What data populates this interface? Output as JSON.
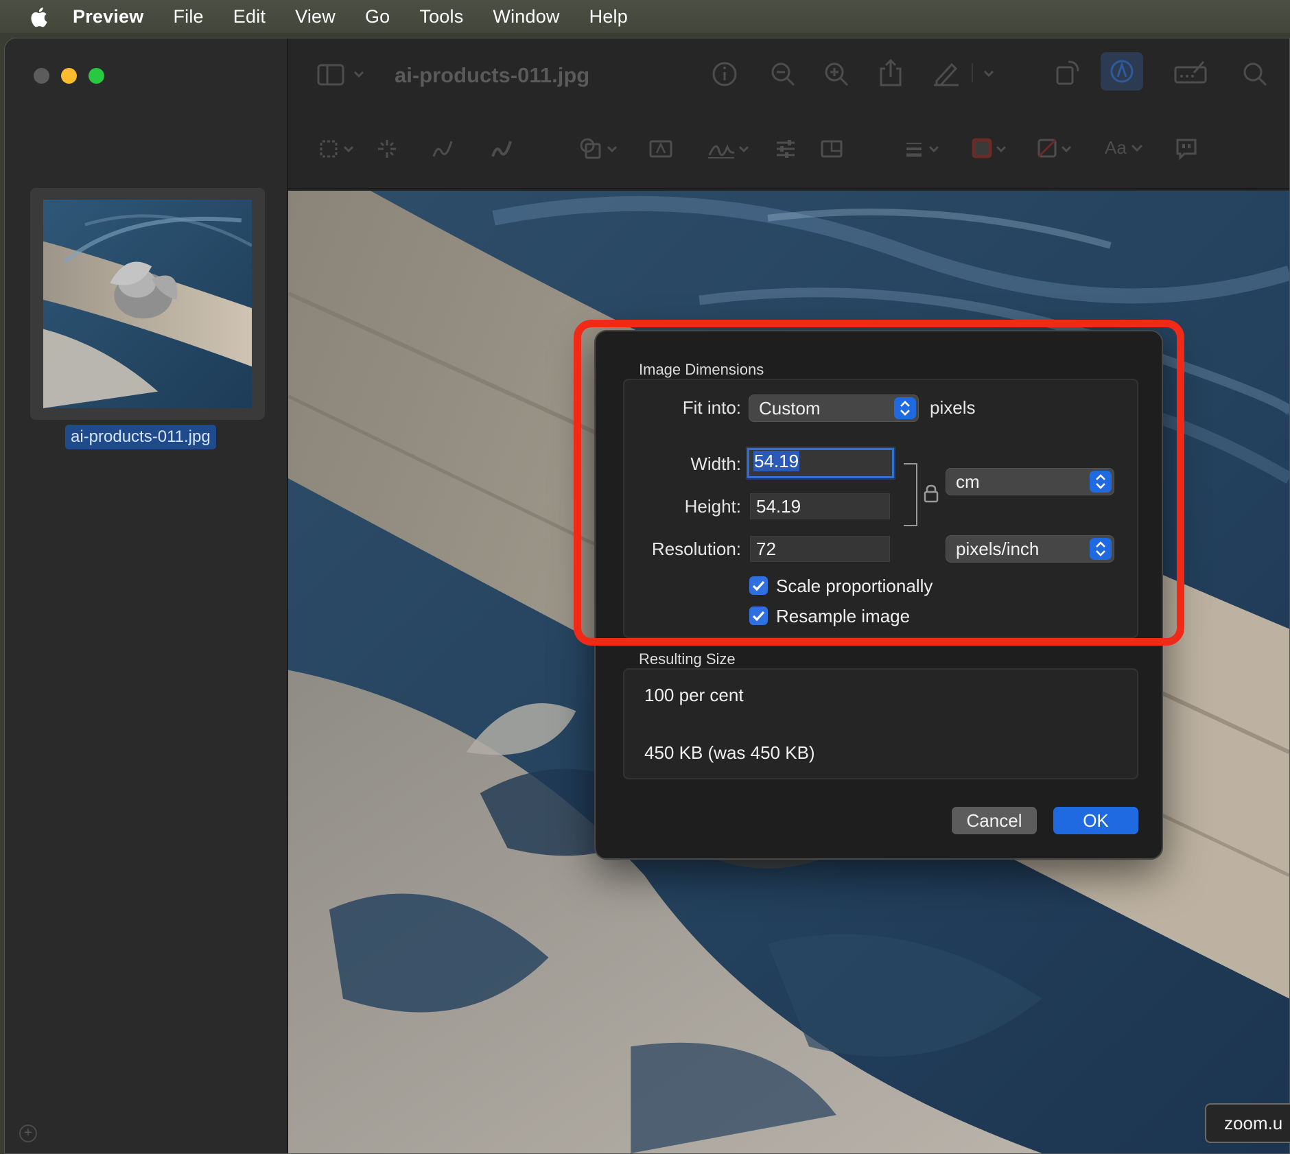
{
  "menubar": {
    "app": "Preview",
    "items": [
      "File",
      "Edit",
      "View",
      "Go",
      "Tools",
      "Window",
      "Help"
    ]
  },
  "window": {
    "title": "ai-products-011.jpg"
  },
  "sidebar": {
    "thumbnail_label": "ai-products-011.jpg"
  },
  "toolbar": {
    "icons": [
      "sidebar-toggle-icon",
      "info-icon",
      "zoom-out-icon",
      "zoom-in-icon",
      "share-icon",
      "highlight-pen-icon",
      "rotate-icon",
      "markup-icon",
      "form-fill-icon",
      "search-icon"
    ],
    "markup_icons": [
      "rect-selection-icon",
      "instant-alpha-icon",
      "sketch-icon",
      "draw-icon",
      "shapes-icon",
      "text-box-icon",
      "signature-icon",
      "adjust-color-icon",
      "adjust-size-icon",
      "line-style-icon",
      "border-color-icon",
      "fill-color-icon",
      "text-style-icon",
      "note-icon"
    ],
    "text_style_label": "Aa"
  },
  "dialog": {
    "image_dimensions_title": "Image Dimensions",
    "fit_into_label": "Fit into:",
    "fit_into_value": "Custom",
    "fit_into_unit": "pixels",
    "width_label": "Width:",
    "width_value": "54.19",
    "height_label": "Height:",
    "height_value": "54.19",
    "resolution_label": "Resolution:",
    "resolution_value": "72",
    "size_unit": "cm",
    "resolution_unit": "pixels/inch",
    "scale_proportionally_label": "Scale proportionally",
    "scale_proportionally_checked": true,
    "resample_label": "Resample image",
    "resample_checked": true,
    "resulting_size_title": "Resulting Size",
    "percent_text": "100 per cent",
    "size_text": "450 KB (was 450 KB)",
    "cancel_label": "Cancel",
    "ok_label": "OK"
  },
  "colors": {
    "highlight": "#f12a17",
    "accent": "#1f6ae0"
  },
  "zoom_badge": {
    "label": "zoom.u"
  }
}
